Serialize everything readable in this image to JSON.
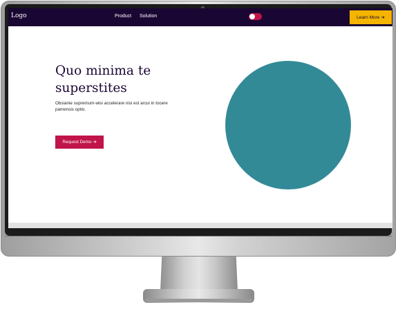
{
  "navbar": {
    "logo": "Logo",
    "links": [
      "Product",
      "Solution"
    ],
    "cta_label": "Learn More",
    "cta_arrow": "➔",
    "theme_toggle_on": true
  },
  "hero": {
    "title": "Quo minima te superstites",
    "text": "Obsianie supremum-wisi accelerare nisi est arcui in tocere pamensis optio.",
    "button_label": "Request Demo",
    "button_arrow": "➔"
  },
  "colors": {
    "navbar_bg": "#1a0633",
    "cta_yellow": "#f5b400",
    "primary_red": "#c0144a",
    "circle_teal": "#338a97"
  }
}
